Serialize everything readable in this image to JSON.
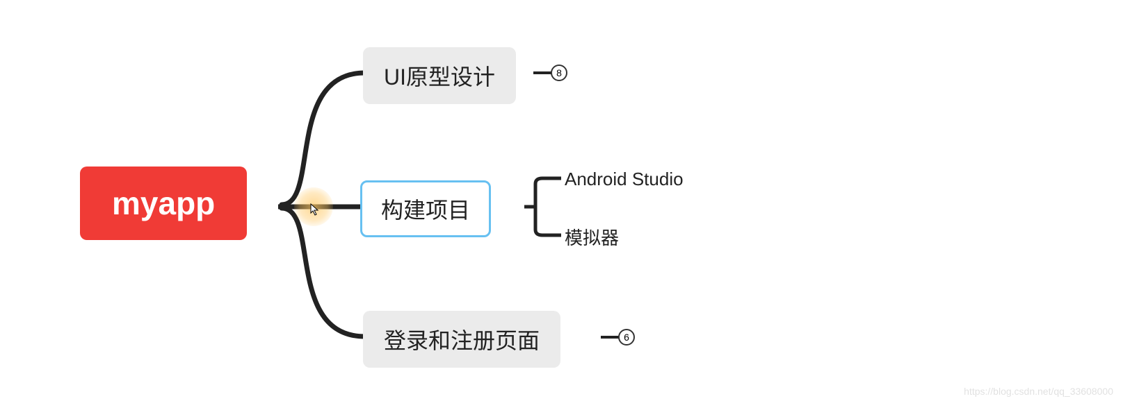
{
  "root": {
    "label": "myapp",
    "color": "#f03b36"
  },
  "branches": [
    {
      "id": "ui-prototype",
      "label": "UI原型设计",
      "badge": "8",
      "selected": false
    },
    {
      "id": "build-project",
      "label": "构建项目",
      "badge": null,
      "selected": true,
      "children": [
        {
          "label": "Android Studio"
        },
        {
          "label": "模拟器"
        }
      ]
    },
    {
      "id": "login-register",
      "label": "登录和注册页面",
      "badge": "6",
      "selected": false
    }
  ],
  "watermark": "https://blog.csdn.net/qq_33608000"
}
